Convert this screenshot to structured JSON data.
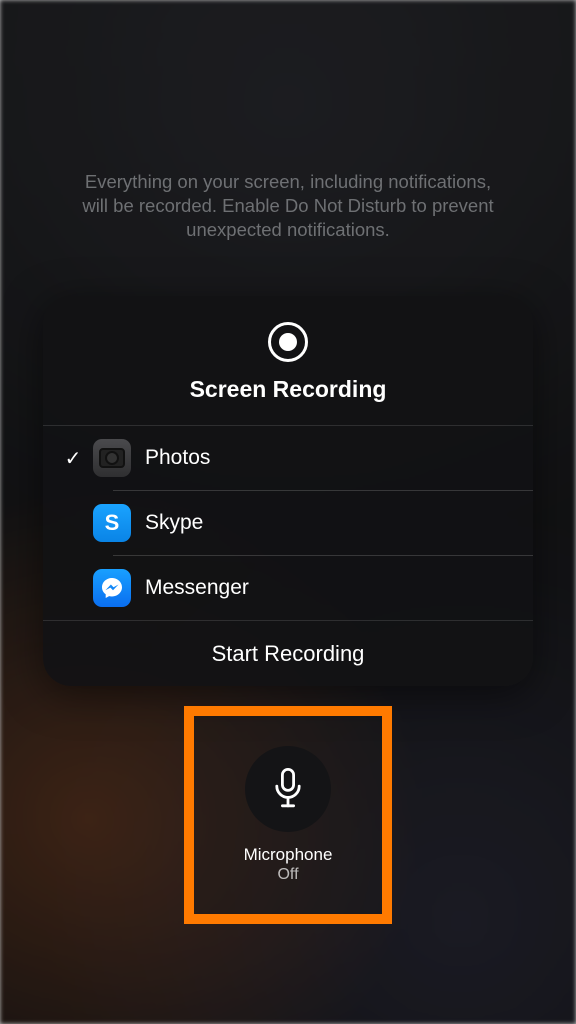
{
  "info_text": "Everything on your screen, including notifications, will be recorded. Enable Do Not Disturb to prevent unexpected notifications.",
  "panel": {
    "title": "Screen Recording",
    "options": [
      {
        "label": "Photos",
        "selected": true,
        "icon": "photos"
      },
      {
        "label": "Skype",
        "selected": false,
        "icon": "skype"
      },
      {
        "label": "Messenger",
        "selected": false,
        "icon": "messenger"
      }
    ],
    "start_label": "Start Recording"
  },
  "mic": {
    "label": "Microphone",
    "status": "Off"
  },
  "highlight_color": "#ff7a00"
}
